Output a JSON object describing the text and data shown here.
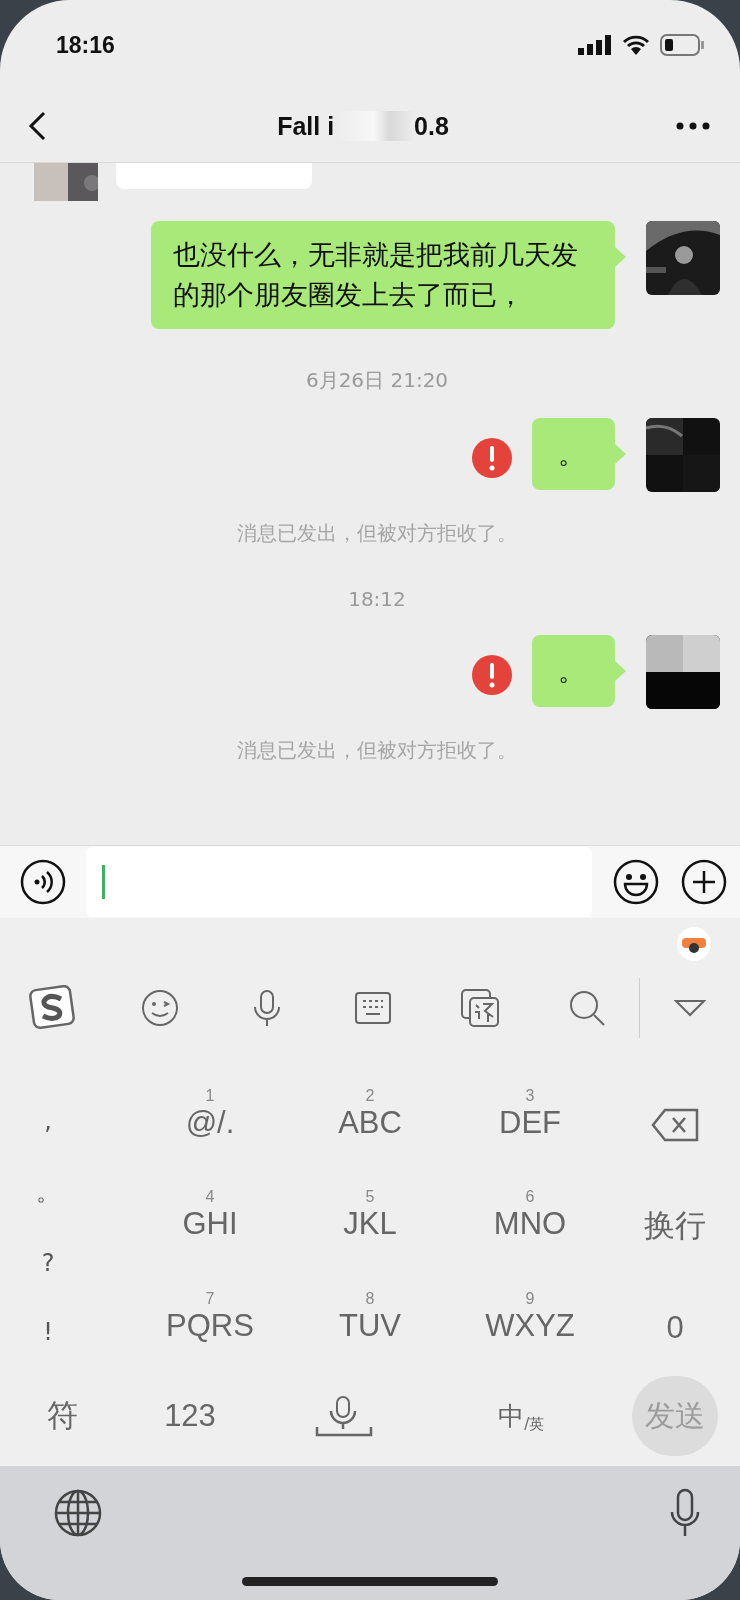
{
  "status_bar": {
    "time": "18:16"
  },
  "nav": {
    "title_start": "Fall i",
    "title_end": "0.8"
  },
  "messages": [
    {
      "kind": "partial_incoming"
    },
    {
      "kind": "outgoing",
      "text": "也没什么，无非就是把我前几天发的那个朋友圈发上去了而已，",
      "failed": false
    },
    {
      "kind": "timestamp",
      "text": "6月26日 21:20"
    },
    {
      "kind": "outgoing",
      "text": "。",
      "failed": true
    },
    {
      "kind": "notice",
      "text": "消息已发出，但被对方拒收了。"
    },
    {
      "kind": "timestamp",
      "text": "18:12"
    },
    {
      "kind": "outgoing",
      "text": "。",
      "failed": true
    },
    {
      "kind": "notice",
      "text": "消息已发出，但被对方拒收了。"
    }
  ],
  "keyboard": {
    "punctuation": [
      ",",
      "。",
      "?",
      "!"
    ],
    "keys": [
      {
        "number": "1",
        "letters": "@/."
      },
      {
        "number": "2",
        "letters": "ABC"
      },
      {
        "number": "3",
        "letters": "DEF"
      },
      {
        "number": "4",
        "letters": "GHI"
      },
      {
        "number": "5",
        "letters": "JKL"
      },
      {
        "number": "6",
        "letters": "MNO"
      },
      {
        "number": "7",
        "letters": "PQRS"
      },
      {
        "number": "8",
        "letters": "TUV"
      },
      {
        "number": "9",
        "letters": "WXYZ"
      }
    ],
    "side_keys": [
      {
        "kind": "backspace"
      },
      {
        "kind": "text",
        "label": "换行"
      },
      {
        "kind": "text",
        "label": "0"
      }
    ],
    "bottom_row": {
      "symbols": "符",
      "numbers": "123",
      "lang_main": "中",
      "lang_alt": "/英",
      "send": "发送",
      "send_disabled": true
    }
  }
}
